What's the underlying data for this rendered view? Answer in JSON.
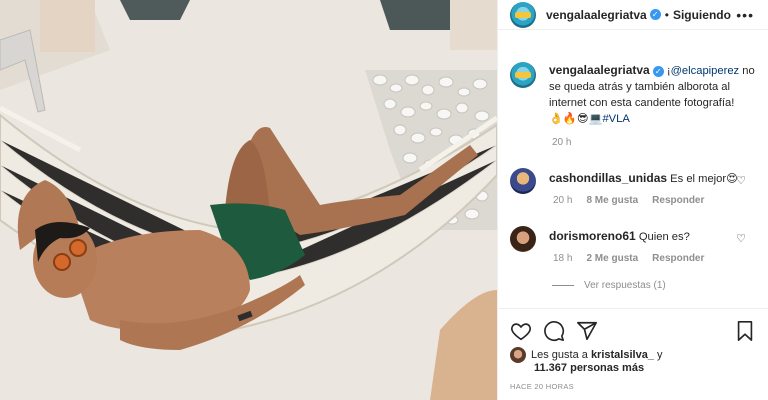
{
  "post_header": {
    "username": "vengalaalegriatva",
    "separator": "•",
    "follow_label": "Siguiendo",
    "more_icon": "ellipsis-icon"
  },
  "caption": {
    "username": "vengalaalegriatva",
    "prefix": "¡",
    "mention": "@elcapiperez",
    "text": " no se queda atrás y también alborota al internet con esta candente fotografía!",
    "emoji_line": "👌🔥😎💻",
    "hashtag": "#VLA",
    "time": "20 h"
  },
  "comments": [
    {
      "username": "cashondillas_unidas",
      "text": "Es el mejor😍",
      "time": "20 h",
      "likes": "8 Me gusta",
      "reply": "Responder"
    },
    {
      "username": "dorismoreno61",
      "text": "Quien es?",
      "time": "18 h",
      "likes": "2 Me gusta",
      "reply": "Responder"
    }
  ],
  "view_replies": "Ver respuestas (1)",
  "actions": {
    "like_icon": "heart-icon",
    "comment_icon": "comment-icon",
    "share_icon": "share-icon",
    "save_icon": "bookmark-icon"
  },
  "likes": {
    "prefix": "Les gusta a ",
    "user": "kristalsilva_",
    "connector": " y",
    "count": "11.367 personas más"
  },
  "posted_ago": "HACE 20 HORAS",
  "colors": {
    "link": "#00376b",
    "verified": "#3897f0",
    "muted": "#8e8e8e"
  }
}
